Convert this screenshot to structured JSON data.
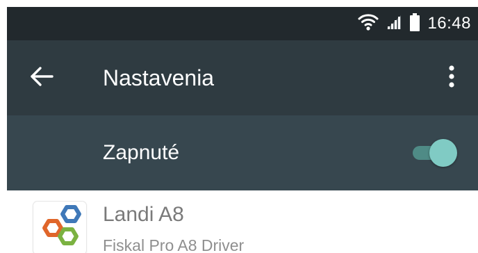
{
  "status_bar": {
    "time": "16:48",
    "icons": [
      "wifi-icon",
      "cell-signal-icon",
      "battery-icon"
    ]
  },
  "app_bar": {
    "title": "Nastavenia",
    "back_icon": "arrow-back-icon",
    "overflow_icon": "more-vert-icon"
  },
  "master_switch": {
    "label": "Zapnuté",
    "on": true
  },
  "list": {
    "items": [
      {
        "title": "Landi A8",
        "subtitle": "Fiskal Pro A8 Driver",
        "icon": "landi-app-icon"
      }
    ]
  },
  "colors": {
    "status_bar": "#22292d",
    "app_bar": "#2f3b41",
    "switch_bar": "#37474f",
    "toggle_thumb": "#80cbc4",
    "toggle_track": "#4f8b86"
  }
}
